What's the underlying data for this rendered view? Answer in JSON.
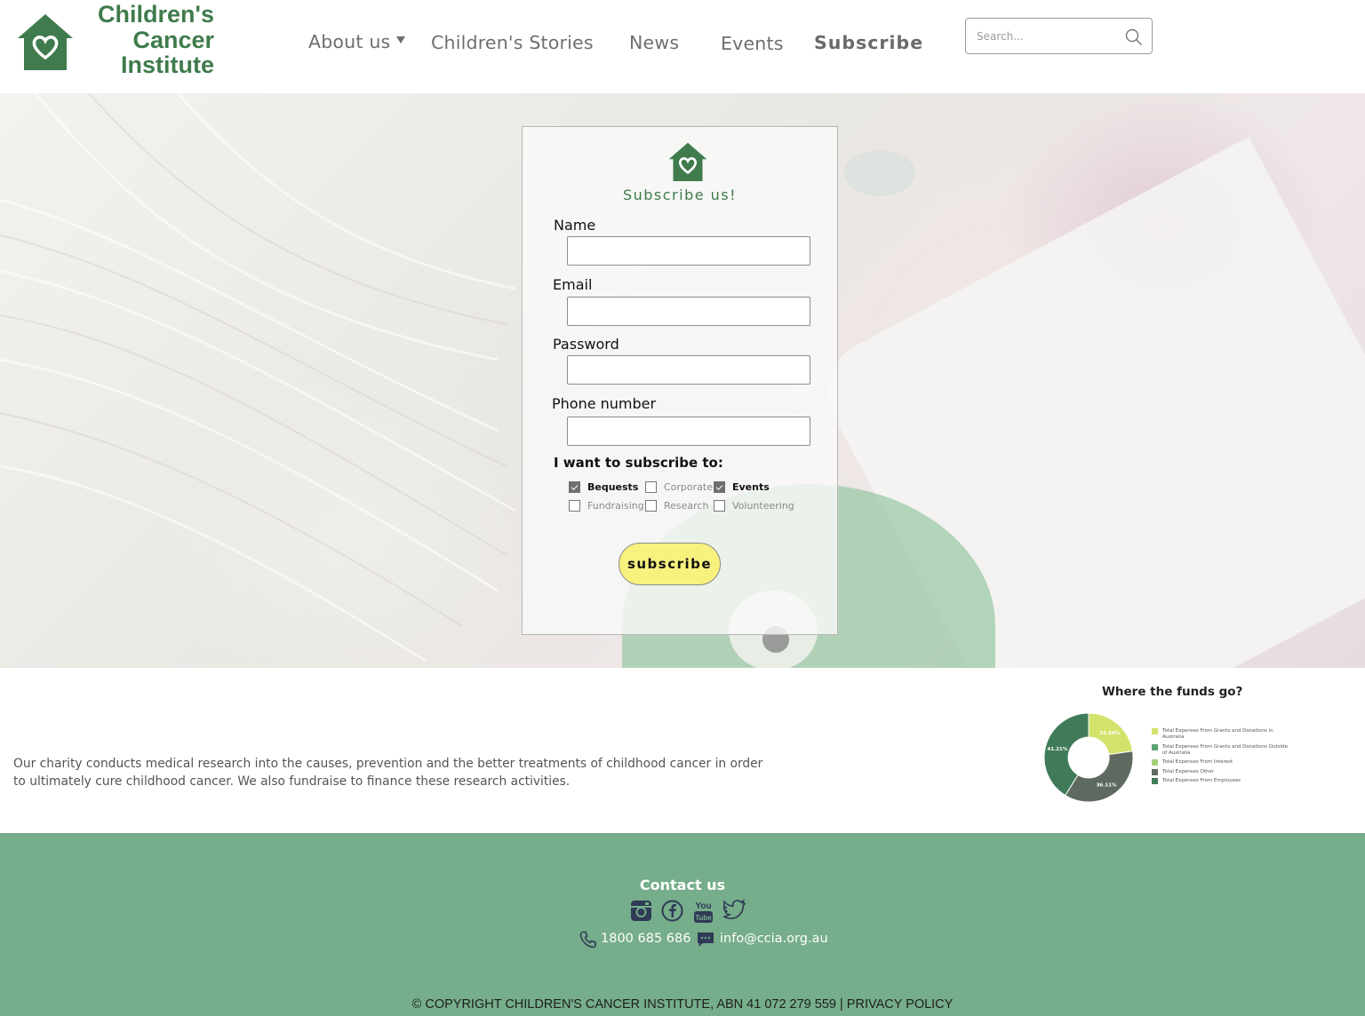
{
  "header": {
    "logo_lines": [
      "Children's",
      "Cancer",
      "Institute"
    ],
    "logo_color": "#3f7b4c",
    "nav": [
      {
        "label": "About us",
        "has_dropdown": true
      },
      {
        "label": "Children's Stories"
      },
      {
        "label": "News"
      },
      {
        "label": "Events"
      },
      {
        "label": "Subscribe",
        "active": true
      }
    ],
    "search": {
      "placeholder": "Search...",
      "value": "",
      "icon": "search-icon"
    }
  },
  "form": {
    "icon": "house-heart-icon",
    "title": "Subscribe us!",
    "fields": [
      {
        "label": "Name",
        "value": ""
      },
      {
        "label": "Email",
        "value": ""
      },
      {
        "label": "Password",
        "value": ""
      },
      {
        "label": "Phone number",
        "value": ""
      }
    ],
    "subscribe_label": "I want to subscribe to:",
    "options": [
      {
        "label": "Bequests",
        "checked": true
      },
      {
        "label": "Corporate",
        "checked": false
      },
      {
        "label": "Events",
        "checked": true
      },
      {
        "label": "Fundraising",
        "checked": false
      },
      {
        "label": "Research",
        "checked": false
      },
      {
        "label": "Volunteering",
        "checked": false
      }
    ],
    "button_label": "subscribe",
    "button_color": "#f7f27e"
  },
  "info": {
    "text": "Our charity conducts medical research into the causes, prevention and the better treatments of childhood cancer in order to ultimately cure childhood cancer. We also fundraise to finance these research activities."
  },
  "chart_data": {
    "type": "pie",
    "title": "Where the funds go?",
    "donut": true,
    "slices": [
      {
        "label": "Total Expenses From Grants and Donations in Australia",
        "value": 22.68,
        "display": "22.68%",
        "color": "#d3e26a"
      },
      {
        "label": "Total Expenses From Grants and Donations Outside of Australia",
        "value": 0,
        "display": "",
        "color": "#5aa271"
      },
      {
        "label": "Total Expenses From Interest",
        "value": 0,
        "display": "",
        "color": "#a3cf7a"
      },
      {
        "label": "Total Expenses Other",
        "value": 36.11,
        "display": "36.11%",
        "color": "#5e6a5f"
      },
      {
        "label": "Total Expenses From Employees",
        "value": 41.21,
        "display": "41.21%",
        "color": "#3f7b58"
      }
    ],
    "legend_position": "right"
  },
  "footer": {
    "contact_title": "Contact us",
    "social_icons": [
      "instagram-icon",
      "facebook-icon",
      "youtube-icon",
      "twitter-icon"
    ],
    "phone": "1800 685 686",
    "email": "info@ccia.org.au",
    "copyright": "© COPYRIGHT CHILDREN'S CANCER INSTITUTE, ABN 41 072 279 559 | PRIVACY POLICY",
    "background": "#76ad8a"
  }
}
